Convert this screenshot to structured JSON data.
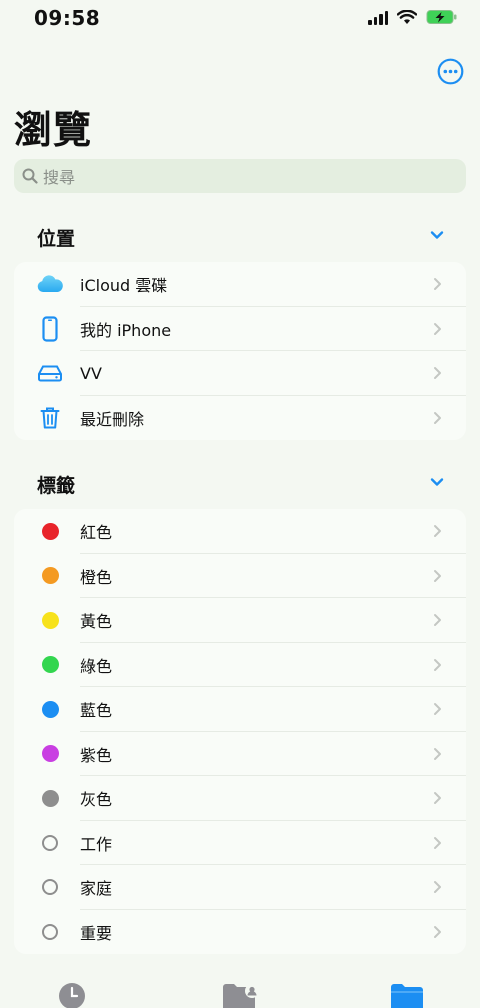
{
  "status": {
    "time": "09:58"
  },
  "page": {
    "title": "瀏覽"
  },
  "search": {
    "placeholder": "搜尋"
  },
  "locations": {
    "title": "位置",
    "items": [
      {
        "label": "iCloud 雲碟",
        "icon": "icloud-icon"
      },
      {
        "label": "我的 iPhone",
        "icon": "iphone-icon"
      },
      {
        "label": "VV",
        "icon": "external-drive-icon"
      },
      {
        "label": "最近刪除",
        "icon": "trash-icon"
      }
    ]
  },
  "tags": {
    "title": "標籤",
    "items": [
      {
        "label": "紅色",
        "color": "#e8242a",
        "hollow": false
      },
      {
        "label": "橙色",
        "color": "#f49a22",
        "hollow": false
      },
      {
        "label": "黃色",
        "color": "#f7e21c",
        "hollow": false
      },
      {
        "label": "綠色",
        "color": "#33d64f",
        "hollow": false
      },
      {
        "label": "藍色",
        "color": "#1c8ef2",
        "hollow": false
      },
      {
        "label": "紫色",
        "color": "#c93fe2",
        "hollow": false
      },
      {
        "label": "灰色",
        "color": "#8e8e8e",
        "hollow": false
      },
      {
        "label": "工作",
        "color": "#8e8e8e",
        "hollow": true
      },
      {
        "label": "家庭",
        "color": "#8e8e8e",
        "hollow": true
      },
      {
        "label": "重要",
        "color": "#8e8e8e",
        "hollow": true
      }
    ]
  },
  "theme": {
    "accent": "#1c8ef2"
  }
}
